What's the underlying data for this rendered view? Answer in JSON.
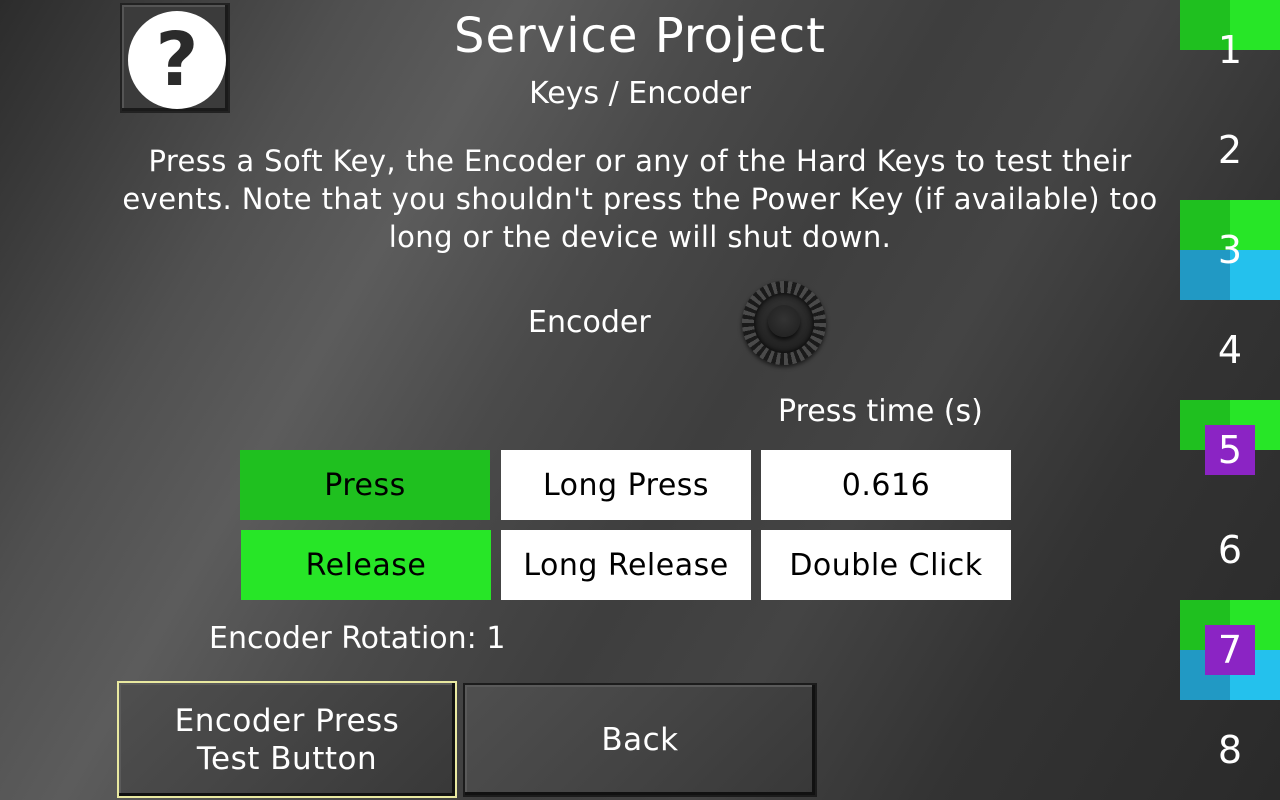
{
  "header": {
    "help_glyph": "?",
    "title": "Service Project",
    "subtitle": "Keys / Encoder"
  },
  "description": "Press a Soft Key, the Encoder or any of the Hard Keys to test their events. Note that you shouldn't press the Power Key (if available) too long or the device will shut down.",
  "encoder": {
    "label": "Encoder",
    "icon": "encoder-knob-icon"
  },
  "press_time": {
    "label": "Press time (s)",
    "value": "0.616"
  },
  "events": {
    "press": "Press",
    "long_press": "Long Press",
    "release": "Release",
    "long_release": "Long Release",
    "double_click": "Double Click",
    "active": [
      "press",
      "release"
    ]
  },
  "rotation": {
    "label": "Encoder Rotation:",
    "value": "1"
  },
  "buttons": {
    "encoder_press_line1": "Encoder Press",
    "encoder_press_line2": "Test Button",
    "back": "Back"
  },
  "softkeys": [
    {
      "label": "1",
      "quadrants": {
        "tl": "#1fc01f",
        "tr": "#27e627"
      }
    },
    {
      "label": "2",
      "quadrants": {}
    },
    {
      "label": "3",
      "quadrants": {
        "tl": "#1fc01f",
        "tr": "#27e627",
        "bl": "#2199c4",
        "br": "#24c1ed"
      }
    },
    {
      "label": "4",
      "quadrants": {}
    },
    {
      "label": "5",
      "quadrants": {
        "tl": "#1fc01f",
        "tr": "#27e627"
      },
      "badge": "#8b24c4"
    },
    {
      "label": "6",
      "quadrants": {}
    },
    {
      "label": "7",
      "quadrants": {
        "tl": "#1fc01f",
        "tr": "#27e627",
        "bl": "#2199c4",
        "br": "#24c1ed"
      },
      "badge": "#8b24c4"
    },
    {
      "label": "8",
      "quadrants": {}
    }
  ],
  "colors": {
    "press_active": "#1fc01f",
    "release_active": "#27e627",
    "inactive": "#ffffff",
    "focus_border": "#e9e9a0"
  }
}
